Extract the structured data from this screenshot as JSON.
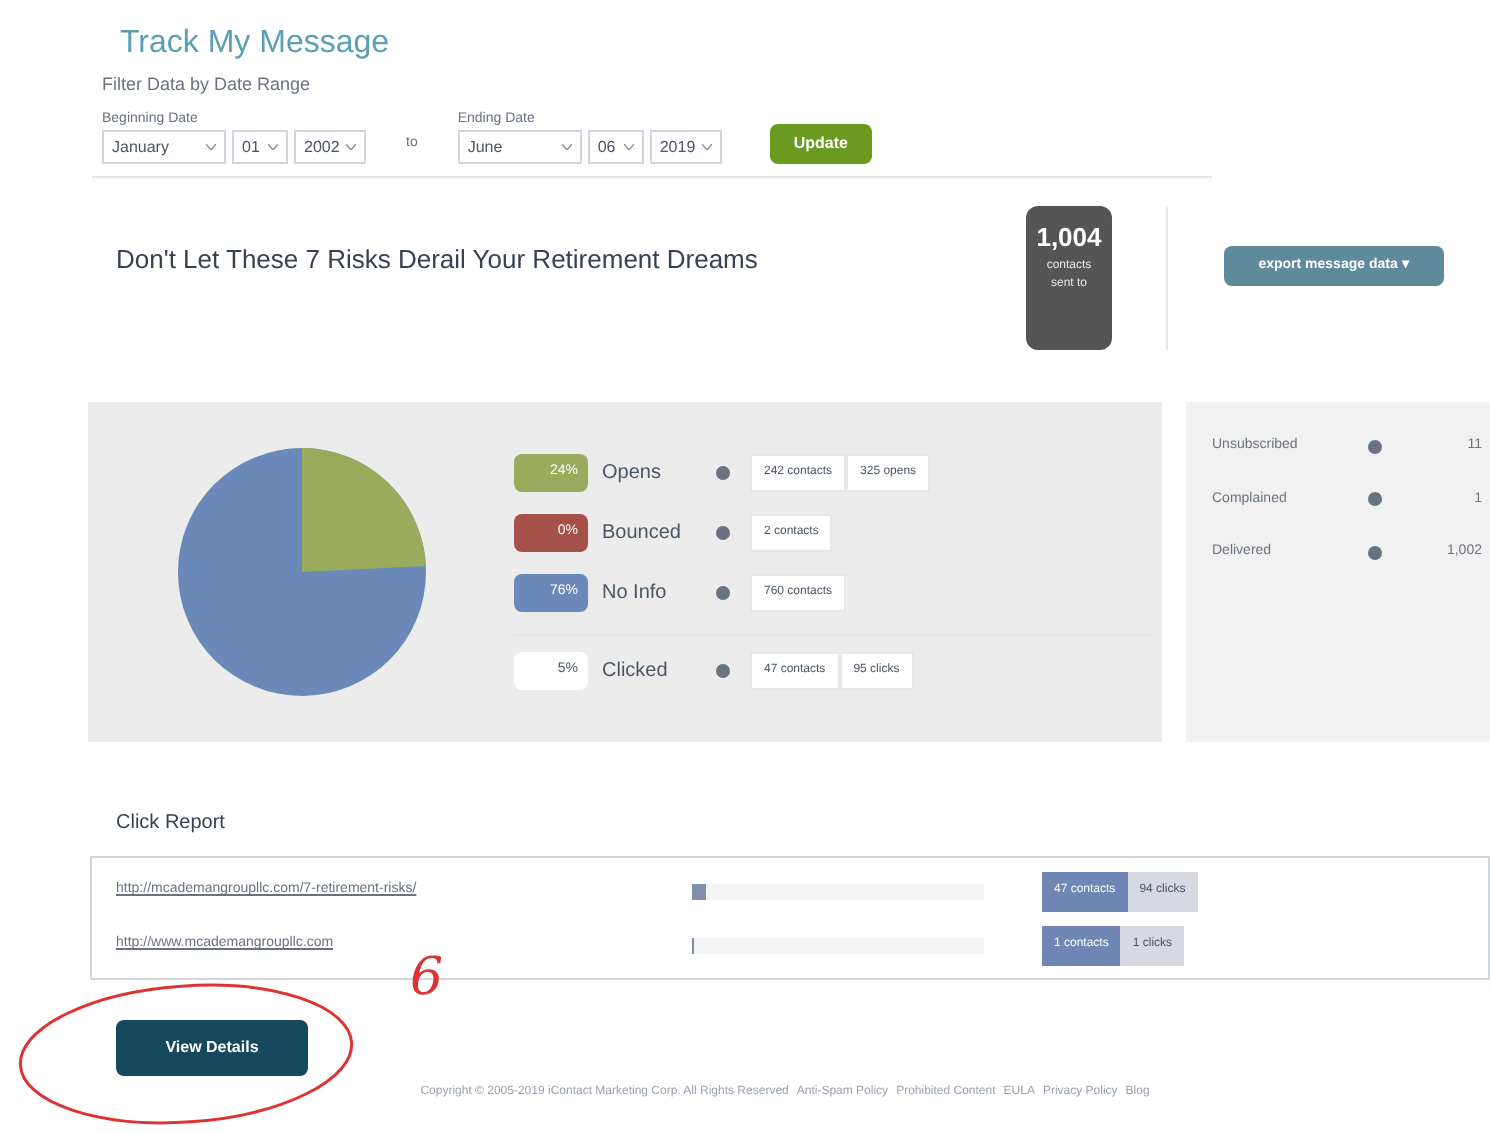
{
  "page_title": "Track My Message",
  "filter": {
    "legend": "Filter Data by Date Range",
    "beginning": {
      "label": "Beginning Date",
      "month": "January",
      "day": "01",
      "year": "2002"
    },
    "separator": "to",
    "ending": {
      "label": "Ending Date",
      "month": "June",
      "day": "06",
      "year": "2019"
    },
    "button": "Update"
  },
  "message": {
    "subject": "Don't Let These 7 Risks Derail Your Retirement Dreams",
    "sent_count": "1,004",
    "sent_label": "contacts sent to",
    "export_button": "export message data ▾"
  },
  "stats": [
    {
      "percent": "24%",
      "label": "Opens",
      "color": "#9aab5e",
      "pills": [
        "242 contacts",
        "325 opens"
      ]
    },
    {
      "percent": "0%",
      "label": "Bounced",
      "color": "#a6504a",
      "pills": [
        "2 contacts"
      ]
    },
    {
      "percent": "76%",
      "label": "No Info",
      "color": "#6a88b8",
      "pills": [
        "760 contacts"
      ]
    },
    {
      "percent": "5%",
      "label": "Clicked",
      "color": "#ffffff",
      "pills": [
        "47 contacts",
        "95 clicks"
      ]
    }
  ],
  "side_stats": [
    {
      "label": "Unsubscribed",
      "value": "11"
    },
    {
      "label": "Complained",
      "value": "1"
    },
    {
      "label": "Delivered",
      "value": "1,002"
    }
  ],
  "click_report": {
    "title": "Click Report",
    "rows": [
      {
        "url": "http://mcademangroupllc.com/7-retirement-risks/",
        "level": 0.05,
        "contacts": "47 contacts",
        "clicks": "94 clicks"
      },
      {
        "url": "http://www.mcademangroupllc.com",
        "level": 0.01,
        "contacts": "1 contacts",
        "clicks": "1 clicks"
      }
    ]
  },
  "view_details": "View Details",
  "footer": {
    "copyright": "Copyright © 2005-2019 iContact Marketing Corp. All Rights Reserved",
    "links": [
      "Anti-Spam Policy",
      "Prohibited Content",
      "EULA",
      "Privacy Policy",
      "Blog"
    ]
  },
  "annotation": {
    "text": "6"
  }
}
